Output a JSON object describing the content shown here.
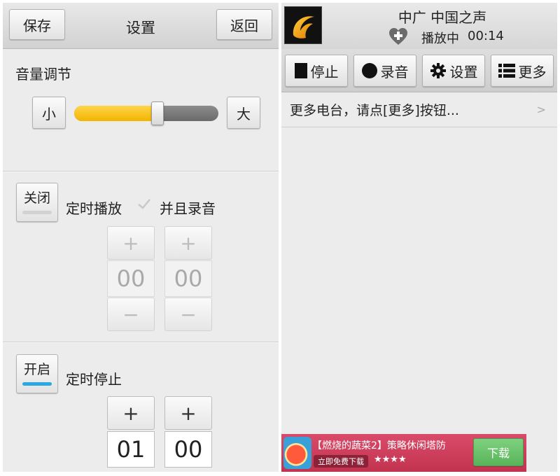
{
  "settings": {
    "save_label": "保存",
    "title": "设置",
    "back_label": "返回",
    "volume": {
      "label": "音量调节",
      "min_label": "小",
      "max_label": "大",
      "level_percent": 58
    },
    "timer_play": {
      "toggle_label": "关闭",
      "toggle_on": false,
      "label": "定时播放",
      "record_label": "并且录音",
      "hours": "00",
      "minutes": "00",
      "plus": "+",
      "minus": "−"
    },
    "timer_stop": {
      "toggle_label": "开启",
      "toggle_on": true,
      "label": "定时停止",
      "hours": "01",
      "minutes": "00",
      "plus": "+"
    }
  },
  "player": {
    "station": "中广 中国之声",
    "status": "播放中",
    "time": "00:14",
    "toolbar": [
      {
        "label": "停止",
        "icon": "stop-icon"
      },
      {
        "label": "录音",
        "icon": "record-icon"
      },
      {
        "label": "设置",
        "icon": "gear-icon"
      },
      {
        "label": "更多",
        "icon": "list-icon"
      }
    ],
    "more_stations_text": "更多电台，请点[更多]按钮...",
    "more_arrow": ">"
  },
  "ad": {
    "title": "【燃烧的蔬菜2】策略休闲塔防",
    "free_label": "立即免费下载",
    "stars": "★★★★",
    "download_label": "下载"
  },
  "colors": {
    "slider_fill": "#f5bb00",
    "toggle_on_bar": "#2aa9e0",
    "ad_background": "#cf3f5e",
    "download_button": "#69c46a"
  }
}
